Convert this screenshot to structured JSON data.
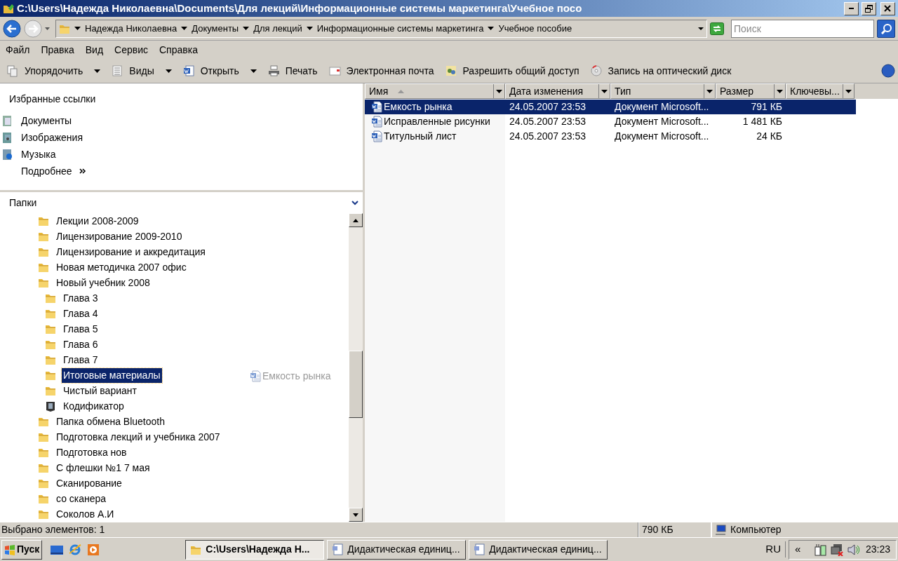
{
  "window": {
    "title": "C:\\Users\\Надежда Николаевна\\Documents\\Для лекций\\Информационные системы маркетинга\\Учебное посо"
  },
  "address_bar": {
    "segments": [
      "Надежда Николаевна",
      "Документы",
      "Для лекций",
      "Информационные системы маркетинга",
      "Учебное пособие"
    ]
  },
  "search": {
    "placeholder": "Поиск"
  },
  "menu": [
    "Файл",
    "Правка",
    "Вид",
    "Сервис",
    "Справка"
  ],
  "toolbar": [
    {
      "label": "Упорядочить",
      "kind": "organize",
      "dropdown": true
    },
    {
      "label": "Виды",
      "kind": "views",
      "dropdown": true
    },
    {
      "label": "Открыть",
      "kind": "open",
      "dropdown": true
    },
    {
      "label": "Печать",
      "kind": "print",
      "dropdown": false
    },
    {
      "label": "Электронная почта",
      "kind": "mail",
      "dropdown": false
    },
    {
      "label": "Разрешить общий доступ",
      "kind": "share",
      "dropdown": false
    },
    {
      "label": "Запись на оптический диск",
      "kind": "burn",
      "dropdown": false
    }
  ],
  "favorites": {
    "title": "Избранные ссылки",
    "items": [
      {
        "label": "Документы",
        "kind": "documents"
      },
      {
        "label": "Изображения",
        "kind": "pictures"
      },
      {
        "label": "Музыка",
        "kind": "music"
      }
    ],
    "more": "Подробнее"
  },
  "folders": {
    "title": "Папки",
    "tree": [
      {
        "label": "Лекции 2008-2009",
        "kind": "folder",
        "selected": false
      },
      {
        "label": "Лицензирование 2009-2010",
        "kind": "folder",
        "selected": false
      },
      {
        "label": "Лицензирование и аккредитация",
        "kind": "folder",
        "selected": false
      },
      {
        "label": "Новая методичка 2007 офис",
        "kind": "folder",
        "selected": false
      },
      {
        "label": "Новый учебник 2008",
        "kind": "folder",
        "selected": false,
        "children": [
          {
            "label": "Глава 3",
            "kind": "folder",
            "selected": false
          },
          {
            "label": "Глава 4",
            "kind": "folder",
            "selected": false
          },
          {
            "label": "Глава 5",
            "kind": "folder",
            "selected": false
          },
          {
            "label": "Глава 6",
            "kind": "folder",
            "selected": false
          },
          {
            "label": "Глава 7",
            "kind": "folder",
            "selected": false
          },
          {
            "label": "Итоговые материалы",
            "kind": "folder",
            "selected": true
          },
          {
            "label": "Чистый вариант",
            "kind": "folder",
            "selected": false
          },
          {
            "label": "Кодификатор",
            "kind": "shortcut",
            "selected": false
          }
        ]
      },
      {
        "label": "Папка обмена Bluetooth",
        "kind": "folder",
        "selected": false
      },
      {
        "label": "Подготовка лекций и учебника 2007",
        "kind": "folder",
        "selected": false
      },
      {
        "label": "Подготовка нов",
        "kind": "folder",
        "selected": false
      },
      {
        "label": "С флешки №1 7 мая",
        "kind": "folder",
        "selected": false
      },
      {
        "label": "Сканирование",
        "kind": "folder",
        "selected": false
      },
      {
        "label": "со сканера",
        "kind": "folder",
        "selected": false
      },
      {
        "label": "Соколов А.И",
        "kind": "folder",
        "selected": false
      }
    ]
  },
  "drag_ghost": {
    "label": "Емкость рынка"
  },
  "file_list": {
    "columns": [
      {
        "label": "Имя",
        "sorted": true
      },
      {
        "label": "Дата изменения",
        "sorted": false
      },
      {
        "label": "Тип",
        "sorted": false
      },
      {
        "label": "Размер",
        "sorted": false
      },
      {
        "label": "Ключевы...",
        "sorted": false
      }
    ],
    "rows": [
      {
        "name": "Емкость рынка",
        "date": "24.05.2007 23:53",
        "type": "Документ Microsoft...",
        "size": "791 КБ",
        "selected": true
      },
      {
        "name": "Исправленные рисунки",
        "date": "24.05.2007 23:53",
        "type": "Документ Microsoft...",
        "size": "1 481 КБ",
        "selected": false
      },
      {
        "name": "Титульный лист",
        "date": "24.05.2007 23:53",
        "type": "Документ Microsoft...",
        "size": "24 КБ",
        "selected": false
      }
    ]
  },
  "status_bar": {
    "selection": "Выбрано элементов: 1",
    "size": "790 КБ",
    "zone": "Компьютер"
  },
  "taskbar": {
    "start": "Пуск",
    "tasks": [
      {
        "label": "C:\\Users\\Надежда Н...",
        "kind": "folder",
        "selected": true
      },
      {
        "label": "Дидактическая единиц...",
        "kind": "document",
        "selected": false
      },
      {
        "label": "Дидактическая единиц...",
        "kind": "document",
        "selected": false
      }
    ],
    "language": "RU",
    "tray_expand": "«",
    "clock": "23:23"
  }
}
